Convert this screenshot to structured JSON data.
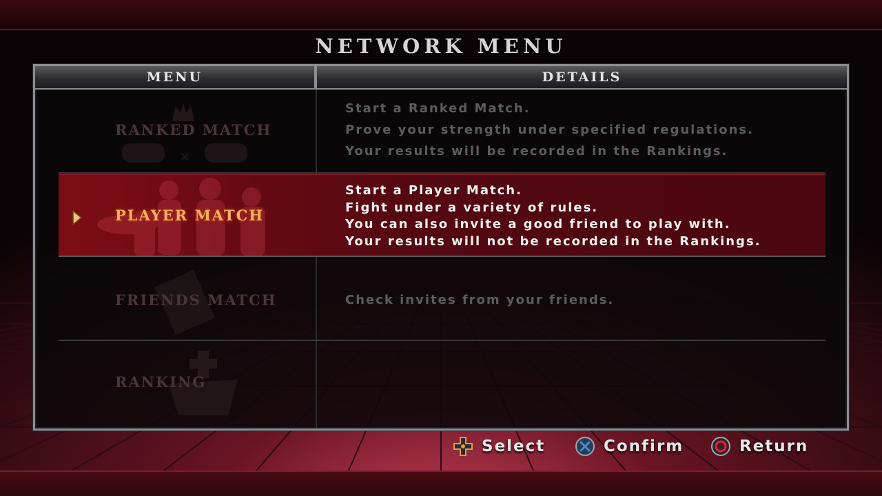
{
  "page_title": "NETWORK MENU",
  "columns": {
    "menu": "MENU",
    "details": "DETAILS"
  },
  "menu_items": [
    {
      "label": "RANKED MATCH",
      "selected": false,
      "details": [
        "Start a Ranked Match.",
        "Prove your strength under specified regulations.",
        "Your results will be recorded in the Rankings."
      ]
    },
    {
      "label": "PLAYER MATCH",
      "selected": true,
      "details": [
        "Start a Player Match.",
        "Fight under a variety of rules.",
        "You can also invite a good friend to play with.",
        "Your results will not be recorded in the Rankings."
      ]
    },
    {
      "label": "FRIENDS MATCH",
      "selected": false,
      "details": [
        "Check invites from your friends."
      ]
    },
    {
      "label": "RANKING",
      "selected": false,
      "details": []
    }
  ],
  "controls": [
    {
      "icon": "dpad-icon",
      "label": "Select"
    },
    {
      "icon": "cross-button-icon",
      "label": "Confirm"
    },
    {
      "icon": "circle-button-icon",
      "label": "Return"
    }
  ],
  "colors": {
    "accent_red": "#7d0d14",
    "selected_text": "#f4b060",
    "frame": "#8d8d92",
    "cross_blue": "#3d8fd8",
    "circle_red": "#d8283a"
  }
}
